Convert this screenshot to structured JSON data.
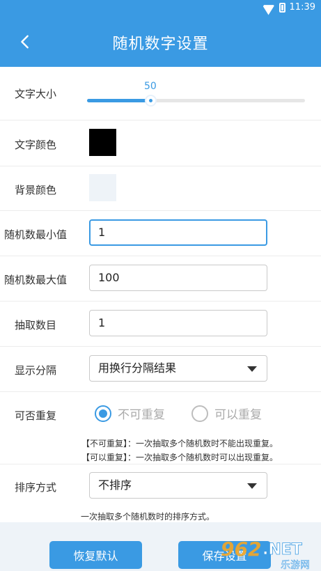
{
  "status": {
    "time": "11:39"
  },
  "appbar": {
    "title": "随机数字设置",
    "back_icon": "back-arrow-icon"
  },
  "settings": {
    "font_size": {
      "label": "文字大小",
      "value": "50",
      "percent": 0.29
    },
    "text_color": {
      "label": "文字颜色",
      "color": "#000000"
    },
    "bg_color": {
      "label": "背景颜色",
      "color": "#eef3f8"
    },
    "min_value": {
      "label": "随机数最小值",
      "value": "1"
    },
    "max_value": {
      "label": "随机数最大值",
      "value": "100"
    },
    "pick_count": {
      "label": "抽取数目",
      "value": "1"
    },
    "separator": {
      "label": "显示分隔",
      "selected": "用换行分隔结果"
    },
    "repeat": {
      "label": "可否重复",
      "options": [
        "不可重复",
        "可以重复"
      ],
      "selected_index": 0,
      "notes": [
        "【不可重复】：一次抽取多个随机数时不能出现重复。",
        "【可以重复】：一次抽取多个随机数时可以出现重复。"
      ]
    },
    "sort": {
      "label": "排序方式",
      "selected": "不排序",
      "note": "一次抽取多个随机数时的排序方式。"
    }
  },
  "buttons": {
    "reset": "恢复默认",
    "save": "保存设置"
  },
  "watermark": {
    "brand": "962",
    "net": ".NET",
    "site": "乐游网"
  },
  "colors": {
    "accent": "#3a9ae3",
    "footer_bg": "#eef3f8"
  }
}
